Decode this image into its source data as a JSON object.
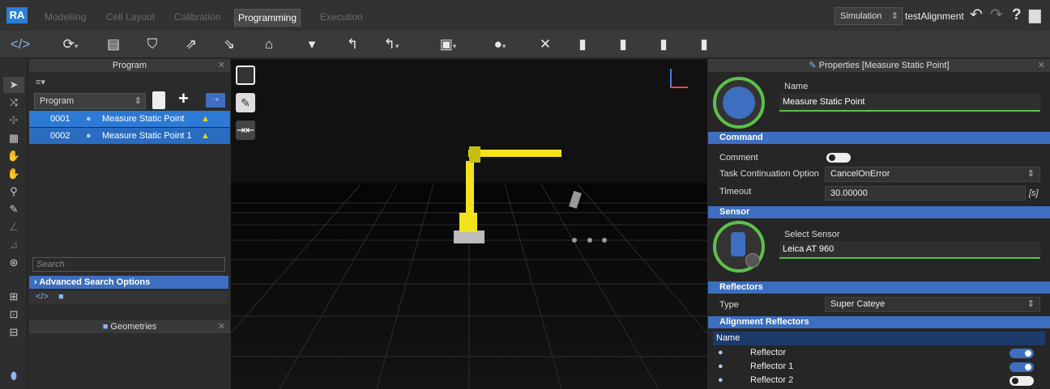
{
  "app": {
    "logo": "RA",
    "tabs": [
      "Modelling",
      "Cell Layout",
      "Calibration",
      "Programming",
      "Execution"
    ],
    "active_tab": "Programming",
    "mode": "Simulation",
    "project": "testAlignment"
  },
  "icons": {
    "toolbar": [
      "code-icon",
      "rotate-dropdown-icon",
      "list-icon",
      "shield-icon",
      "move-icon",
      "move-home-icon",
      "move-path-icon",
      "tool-icon",
      "arc-icon",
      "arc-dropdown-icon",
      "screen-dropdown-icon",
      "camera-dropdown-icon",
      "cross-icon",
      "sensor-play-icon",
      "sensor-record-icon",
      "sensor-refresh-icon",
      "sensor-lock-icon"
    ]
  },
  "program_panel": {
    "title": "Program",
    "select_value": "Program",
    "rows": [
      {
        "num": "0001",
        "name": "Measure Static Point"
      },
      {
        "num": "0002",
        "name": "Measure Static Point 1"
      }
    ],
    "search_placeholder": "Search",
    "advanced": "Advanced Search Options",
    "geometries_title": "Geometries"
  },
  "properties": {
    "title": "Properties [Measure Static Point]",
    "name_label": "Name",
    "name_value": "Measure Static Point",
    "command_section": "Command",
    "comment_label": "Comment",
    "task_label": "Task Continuation Option",
    "task_value": "CancelOnError",
    "timeout_label": "Timeout",
    "timeout_value": "30.00000",
    "timeout_unit": "[s]",
    "sensor_section": "Sensor",
    "select_sensor_label": "Select Sensor",
    "sensor_value": "Leica AT 960",
    "reflectors_section": "Reflectors",
    "type_label": "Type",
    "type_value": "Super Cateye",
    "alignment_section": "Alignment Reflectors",
    "table_header": "Name",
    "reflectors": [
      {
        "name": "Reflector",
        "enabled": true
      },
      {
        "name": "Reflector 1",
        "enabled": true
      },
      {
        "name": "Reflector 2",
        "enabled": false
      }
    ]
  },
  "colors": {
    "accent": "#3d6ebf",
    "selection": "#2d7ad6",
    "field_line": "#5cc04a",
    "robot": "#f2e21a"
  }
}
